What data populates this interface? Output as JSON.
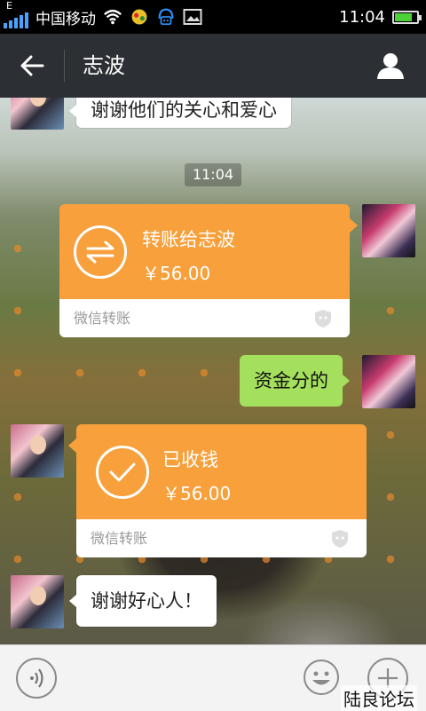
{
  "status_bar": {
    "network_type": "E",
    "carrier": "中国移动",
    "time": "11:04",
    "battery_level": 0.8,
    "icons": [
      "signal-icon",
      "wifi-icon",
      "app-notification-icon",
      "qq-icon",
      "image-icon",
      "battery-icon"
    ]
  },
  "header": {
    "back_icon": "back-arrow-icon",
    "title": "志波",
    "profile_icon": "person-icon"
  },
  "messages": {
    "top_partial": {
      "text": "谢谢他们的关心和爱心",
      "sender": "other"
    },
    "timestamp": "11:04",
    "transfer_sent": {
      "title": "转账给志波",
      "amount": "￥56.00",
      "footer": "微信转账",
      "sender": "me"
    },
    "text_sent": {
      "text": "资金分的",
      "sender": "me"
    },
    "transfer_received": {
      "title": "已收钱",
      "amount": "￥56.00",
      "footer": "微信转账",
      "sender": "other"
    },
    "text_received": {
      "text": "谢谢好心人！",
      "sender": "other"
    }
  },
  "input_bar": {
    "voice_icon": "voice-icon",
    "emoji_icon": "emoji-icon",
    "more_icon": "plus-icon"
  },
  "watermark": "陆良论坛",
  "colors": {
    "transfer_orange": "#f7a03c",
    "sent_green": "#a4e05d",
    "header_bg": "#2c2f33"
  }
}
